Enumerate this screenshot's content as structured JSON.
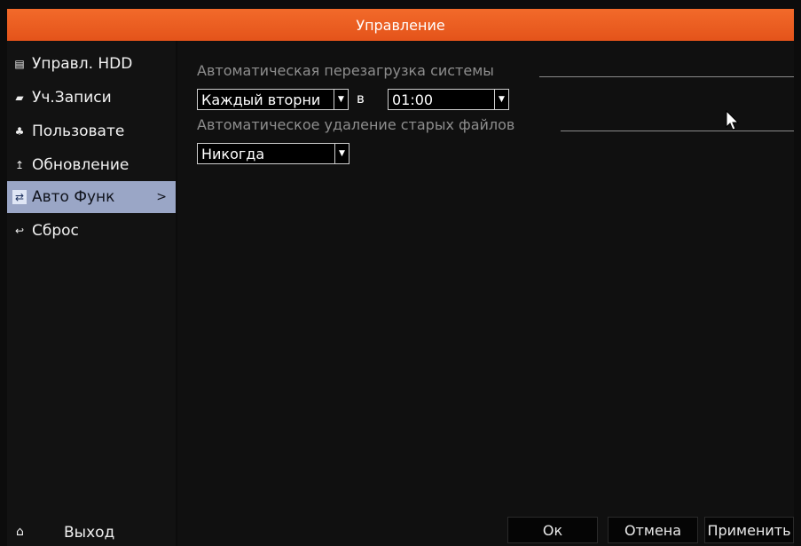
{
  "window": {
    "title": "Управление"
  },
  "sidebar": {
    "items": [
      {
        "label": "Управл. HDD",
        "icon": "hdd-icon"
      },
      {
        "label": "Уч.Записи",
        "icon": "folder-icon"
      },
      {
        "label": "Пользовате",
        "icon": "users-icon"
      },
      {
        "label": "Обновление",
        "icon": "upgrade-icon"
      },
      {
        "label": "Авто Функ",
        "icon": "auto-function-icon",
        "active": true
      },
      {
        "label": "Сброс",
        "icon": "reset-icon"
      }
    ],
    "active_chevron": ">",
    "exit_label": "Выход"
  },
  "auto_reboot": {
    "title": "Автоматическая перезагрузка системы",
    "day_value": "Каждый вторни",
    "at_label": "в",
    "time_value": "01:00"
  },
  "auto_delete": {
    "title": "Автоматическое удаление старых файлов",
    "value": "Никогда"
  },
  "footer": {
    "ok_label": "Ок",
    "cancel_label": "Отмена",
    "apply_label": "Применить"
  },
  "colors": {
    "title_bar": "#e85a20",
    "active_item": "#9aa6c6",
    "background": "#101010"
  }
}
